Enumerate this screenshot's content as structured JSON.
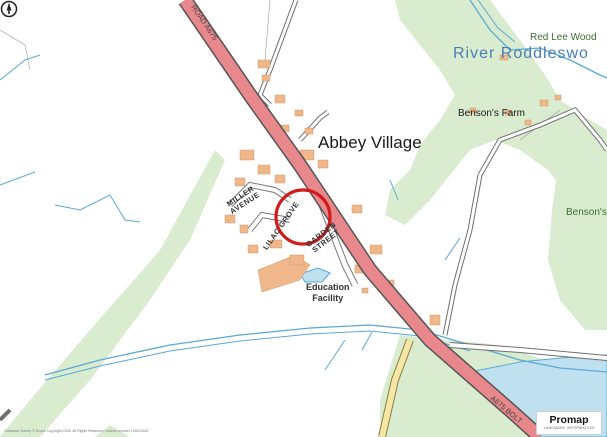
{
  "labels": {
    "place": "Abbey Village",
    "farm": "Benson's Farm",
    "wood": "Red Lee Wood",
    "river": "River Roddleswo",
    "benson_edge": "Benson's",
    "miller_line1": "MILLER",
    "miller_line2": "AVENUE",
    "lilac_grove": "LILAC GROVE",
    "garden_line1": "GARDEN",
    "garden_line2": "STREET",
    "road_north": "ROAD A675",
    "road_south": "A675 BOLT",
    "education_line1": "Education",
    "education_line2": "Facility"
  },
  "marker": {
    "shape": "circle",
    "color": "#d11a1a"
  },
  "branding": {
    "name": "Promap",
    "tagline": "LANDMARK INFORMATION"
  },
  "copyright": "Ordnance Survey © Crown Copyright 2025. All Rights Reserved. Licence number 100022432",
  "compass": {
    "icon": "north-arrow-icon"
  },
  "colors": {
    "main_road": "#e8888c",
    "minor_road": "#f6e7a6",
    "water": "#bfe0ef",
    "woodland": "#d9eccf",
    "buildings": "#f0b88a",
    "stream": "#5aa9d6"
  }
}
